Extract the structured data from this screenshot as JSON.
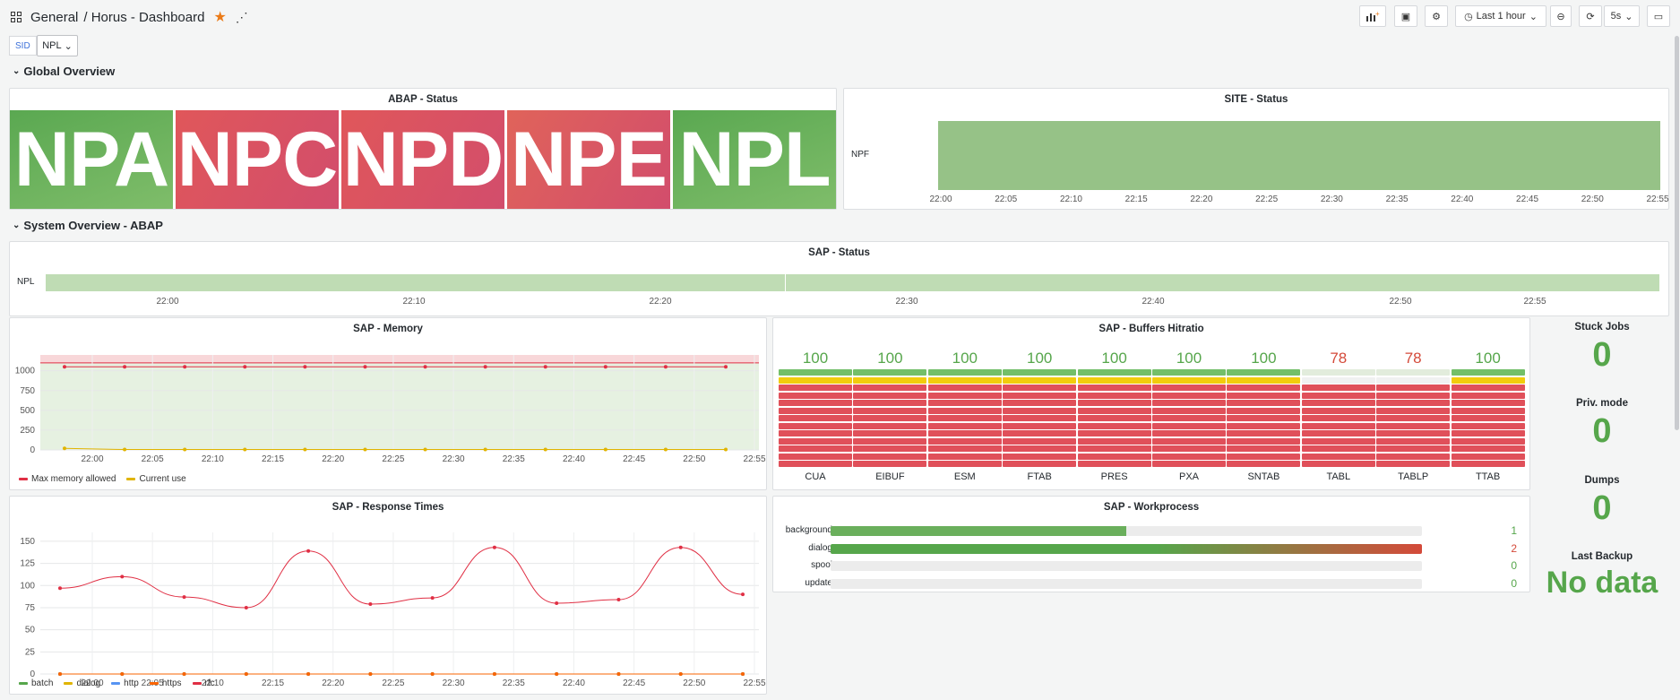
{
  "header": {
    "breadcrumb_root": "General",
    "breadcrumb_page": "/ Horus - Dashboard",
    "time_range": "Last 1 hour",
    "refresh": "5s"
  },
  "variables": {
    "sid_label": "SID",
    "sid_value": "NPL"
  },
  "rows": {
    "global": "Global Overview",
    "system": "System Overview - ABAP"
  },
  "abap_status": {
    "title": "ABAP - Status",
    "systems": [
      "NPA",
      "NPC",
      "NPD",
      "NPE",
      "NPL"
    ],
    "states": [
      "ok",
      "error",
      "error",
      "error",
      "ok"
    ]
  },
  "site_status": {
    "title": "SITE - Status",
    "row_label": "NPF",
    "ticks": [
      "22:00",
      "22:05",
      "22:10",
      "22:15",
      "22:20",
      "22:25",
      "22:30",
      "22:35",
      "22:40",
      "22:45",
      "22:50",
      "22:55"
    ]
  },
  "sap_status": {
    "title": "SAP - Status",
    "row_label": "NPL",
    "ticks": [
      "22:00",
      "22:10",
      "22:20",
      "22:30",
      "22:40",
      "22:50",
      "22:55"
    ]
  },
  "memory": {
    "title": "SAP - Memory",
    "legend": [
      "Max memory allowed",
      "Current use"
    ]
  },
  "buffers": {
    "title": "SAP - Buffers Hitratio",
    "names": [
      "CUA",
      "EIBUF",
      "ESM",
      "FTAB",
      "PRES",
      "PXA",
      "SNTAB",
      "TABL",
      "TABLP",
      "TTAB"
    ],
    "values": [
      "100",
      "100",
      "100",
      "100",
      "100",
      "100",
      "100",
      "78",
      "78",
      "100"
    ]
  },
  "response": {
    "title": "SAP - Response Times",
    "legend": [
      "batch",
      "dialog",
      "http",
      "https",
      "rfc"
    ]
  },
  "workprocess": {
    "title": "SAP - Workprocess",
    "rows": [
      {
        "label": "background",
        "value": "1"
      },
      {
        "label": "dialog",
        "value": "2"
      },
      {
        "label": "spool",
        "value": "0"
      },
      {
        "label": "update",
        "value": "0"
      }
    ]
  },
  "side_stats": {
    "stuck_jobs": {
      "title": "Stuck Jobs",
      "value": "0"
    },
    "priv_mode": {
      "title": "Priv. mode",
      "value": "0"
    },
    "dumps": {
      "title": "Dumps",
      "value": "0"
    },
    "last_backup": {
      "title": "Last Backup",
      "value": "No data"
    }
  },
  "chart_data": [
    {
      "type": "line",
      "title": "SAP - Memory",
      "x": [
        "21:58",
        "22:03",
        "22:08",
        "22:13",
        "22:18",
        "22:23",
        "22:28",
        "22:33",
        "22:38",
        "22:43",
        "22:48",
        "22:53"
      ],
      "series": [
        {
          "name": "Max memory allowed",
          "values": [
            1050,
            1050,
            1050,
            1050,
            1050,
            1050,
            1050,
            1050,
            1050,
            1050,
            1050,
            1050
          ]
        },
        {
          "name": "Current use",
          "values": [
            20,
            5,
            5,
            5,
            5,
            5,
            5,
            5,
            5,
            5,
            5,
            5
          ]
        }
      ],
      "ylim": [
        0,
        1200
      ],
      "yticks": [
        "0",
        "250",
        "500",
        "750",
        "1000"
      ],
      "xticks": [
        "22:00",
        "22:05",
        "22:10",
        "22:15",
        "22:20",
        "22:25",
        "22:30",
        "22:35",
        "22:40",
        "22:45",
        "22:50",
        "22:55"
      ]
    },
    {
      "type": "line",
      "title": "SAP - Response Times",
      "x": [
        "21:58",
        "22:03",
        "22:08",
        "22:13",
        "22:18",
        "22:23",
        "22:28",
        "22:33",
        "22:38",
        "22:43",
        "22:48",
        "22:53"
      ],
      "series": [
        {
          "name": "batch",
          "values": [
            0,
            0,
            0,
            0,
            0,
            0,
            0,
            0,
            0,
            0,
            0,
            0
          ]
        },
        {
          "name": "dialog",
          "values": [
            0,
            0,
            0,
            0,
            0,
            0,
            0,
            0,
            0,
            0,
            0,
            0
          ]
        },
        {
          "name": "http",
          "values": [
            0,
            0,
            0,
            0,
            0,
            0,
            0,
            0,
            0,
            0,
            0,
            0
          ]
        },
        {
          "name": "https",
          "values": [
            0,
            0,
            0,
            0,
            0,
            0,
            0,
            0,
            0,
            0,
            0,
            0
          ]
        },
        {
          "name": "rfc",
          "values": [
            97,
            110,
            87,
            75,
            139,
            79,
            86,
            143,
            80,
            84,
            143,
            90
          ]
        }
      ],
      "ylim": [
        0,
        160
      ],
      "yticks": [
        "0",
        "25",
        "50",
        "75",
        "100",
        "125",
        "150"
      ],
      "xticks": [
        "22:00",
        "22:05",
        "22:10",
        "22:15",
        "22:20",
        "22:25",
        "22:30",
        "22:35",
        "22:40",
        "22:45",
        "22:50",
        "22:55"
      ]
    },
    {
      "type": "bar",
      "title": "SAP - Workprocess",
      "categories": [
        "background",
        "dialog",
        "spool",
        "update"
      ],
      "values": [
        1,
        2,
        0,
        0
      ],
      "ylim": [
        0,
        2
      ]
    },
    {
      "type": "bar",
      "title": "SAP - Buffers Hitratio",
      "categories": [
        "CUA",
        "EIBUF",
        "ESM",
        "FTAB",
        "PRES",
        "PXA",
        "SNTAB",
        "TABL",
        "TABLP",
        "TTAB"
      ],
      "values": [
        100,
        100,
        100,
        100,
        100,
        100,
        100,
        78,
        78,
        100
      ],
      "ylim": [
        0,
        100
      ]
    }
  ],
  "colors": {
    "ok": "#73bf69",
    "error": "#e0505a",
    "green": "#56a64b",
    "red": "#e02f44",
    "yellow": "#f2cc0c",
    "orange": "#fa6400"
  }
}
